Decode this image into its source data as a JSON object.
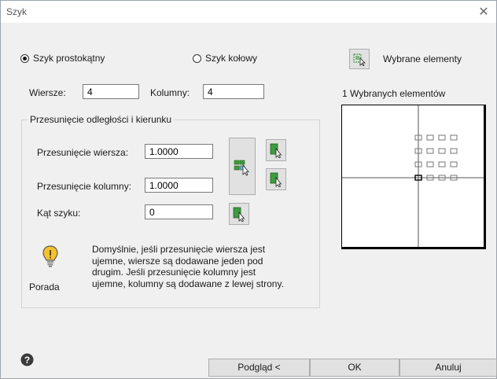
{
  "window": {
    "title": "Szyk",
    "close_glyph": "✕"
  },
  "type": {
    "rect_label": "Szyk prostokątny",
    "rect_selected": true,
    "polar_label": "Szyk kołowy",
    "polar_selected": false
  },
  "selection": {
    "button_label": "Wybrane elementy",
    "count_text": "1 Wybranych elementów"
  },
  "rows": {
    "label": "Wiersze:",
    "value": "4"
  },
  "cols": {
    "label": "Kolumny:",
    "value": "4"
  },
  "offset_group": {
    "title": "Przesunięcie odległości i kierunku",
    "row_offset_label": "Przesunięcie wiersza:",
    "row_offset_value": "1.0000",
    "col_offset_label": "Przesunięcie kolumny:",
    "col_offset_value": "1.0000",
    "angle_label": "Kąt szyku:",
    "angle_value": "0"
  },
  "tip": {
    "label": "Porada",
    "text": "Domyślnie, jeśli przesunięcie wiersza jest\nujemne, wiersze są dodawane jeden pod\ndrugim. Jeśli przesunięcie kolumny jest\nujemne, kolumny są dodawane z lewej strony.",
    "icon": "lightbulb-icon"
  },
  "buttons": {
    "preview": "Podgląd <",
    "ok": "OK",
    "cancel": "Anuluj"
  },
  "help_icon": "help-icon",
  "colors": {
    "accent": "#1a1a1a",
    "icon_green": "#3f9b3f",
    "bulb_yellow": "#f2c230"
  }
}
